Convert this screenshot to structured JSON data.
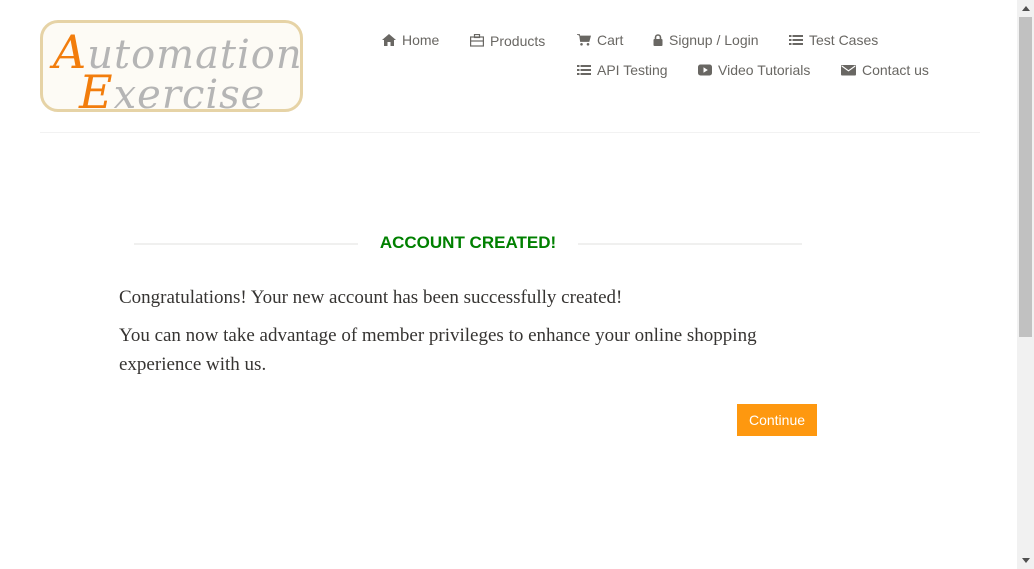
{
  "logo": {
    "line1_accent": "A",
    "line1_rest": "utomation",
    "line2_accent": "E",
    "line2_rest": "xercise"
  },
  "nav": {
    "items": [
      {
        "label": "Home",
        "icon": "home-icon"
      },
      {
        "label": "Products",
        "icon": "briefcase-icon"
      },
      {
        "label": "Cart",
        "icon": "cart-icon"
      },
      {
        "label": "Signup / Login",
        "icon": "lock-icon"
      },
      {
        "label": "Test Cases",
        "icon": "list-icon"
      },
      {
        "label": "API Testing",
        "icon": "list-icon"
      },
      {
        "label": "Video Tutorials",
        "icon": "youtube-play-icon"
      },
      {
        "label": "Contact us",
        "icon": "envelope-icon"
      }
    ]
  },
  "main": {
    "title": "ACCOUNT CREATED!",
    "paragraph1": "Congratulations! Your new account has been successfully created!",
    "paragraph2": "You can now take advantage of member privileges to enhance your online shopping experience with us.",
    "continue_label": "Continue"
  },
  "colors": {
    "title_green": "#008000",
    "button_orange": "#fe980f",
    "logo_accent": "#f27d0c",
    "nav_text": "#696763"
  }
}
